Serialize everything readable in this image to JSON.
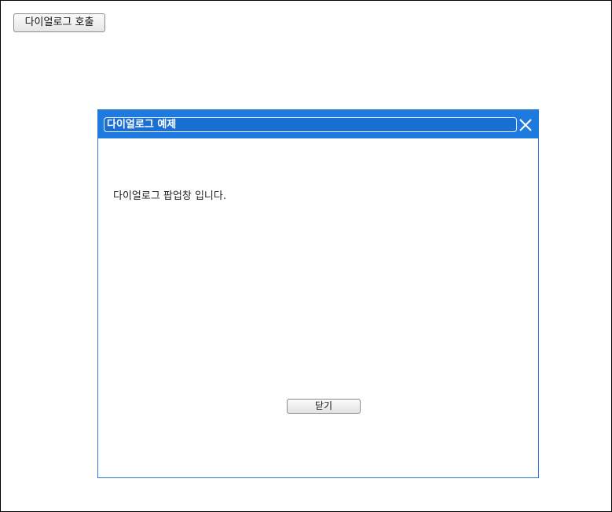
{
  "page": {
    "open_button_label": "다이얼로그 호출"
  },
  "dialog": {
    "title": "다이얼로그 예제",
    "message": "다이얼로그 팝업창 입니다.",
    "close_button_label": "닫기",
    "close_icon": "close-icon",
    "titlebar_color": "#1f7ae0"
  }
}
